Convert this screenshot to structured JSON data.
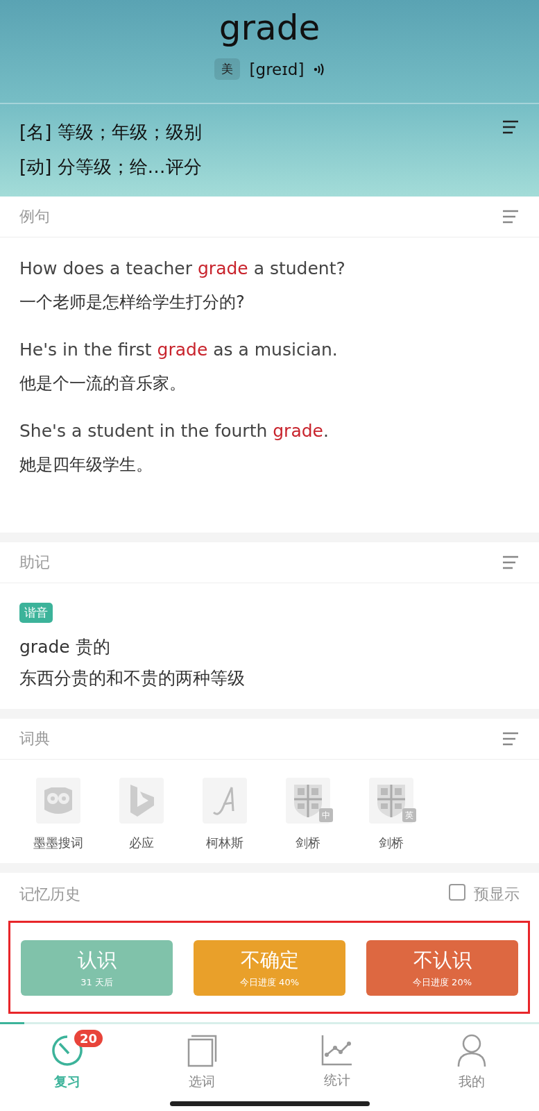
{
  "header": {
    "word": "grade",
    "accent": "美",
    "phonetic": "[greɪd]",
    "definitions": [
      {
        "pos": "[名]",
        "text": "等级；年级；级别"
      },
      {
        "pos": "[动]",
        "text": "分等级；给…评分"
      }
    ]
  },
  "examples": {
    "title": "例句",
    "items": [
      {
        "en": "How does a teacher **grade** a student?",
        "zh": "一个老师是怎样给学生打分的?"
      },
      {
        "en": "He's in the first **grade** as a musician.",
        "zh": "他是个一流的音乐家。"
      },
      {
        "en": "She's a student in the fourth **grade**.",
        "zh": "她是四年级学生。"
      }
    ]
  },
  "mnemonic": {
    "title": "助记",
    "tag": "谐音",
    "lines": [
      "grade 贵的",
      "东西分贵的和不贵的两种等级"
    ]
  },
  "dictionaries": {
    "title": "词典",
    "items": [
      {
        "kind": "owl",
        "label": "墨墨搜词"
      },
      {
        "kind": "bing",
        "label": "必应"
      },
      {
        "kind": "script",
        "label": "柯林斯"
      },
      {
        "kind": "shield",
        "label": "剑桥",
        "badge": "中"
      },
      {
        "kind": "shield",
        "label": "剑桥",
        "badge": "英"
      }
    ]
  },
  "history": {
    "title": "记忆历史",
    "preview": {
      "label": "预显示",
      "checked": false
    }
  },
  "actions": [
    {
      "label": "认识",
      "sub": "31 天后",
      "color": "#80c2aa"
    },
    {
      "label": "不确定",
      "sub": "今日进度 40%",
      "color": "#e9a02a"
    },
    {
      "label": "不认识",
      "sub": "今日进度 20%",
      "color": "#dd6841"
    }
  ],
  "progress": {
    "level": 0.045
  },
  "tabs": [
    {
      "kind": "timer",
      "label": "复习",
      "selected": true,
      "badge": "20"
    },
    {
      "kind": "cards",
      "label": "选词",
      "selected": false
    },
    {
      "kind": "chart",
      "label": "统计",
      "selected": false
    },
    {
      "kind": "person",
      "label": "我的",
      "selected": false
    }
  ]
}
